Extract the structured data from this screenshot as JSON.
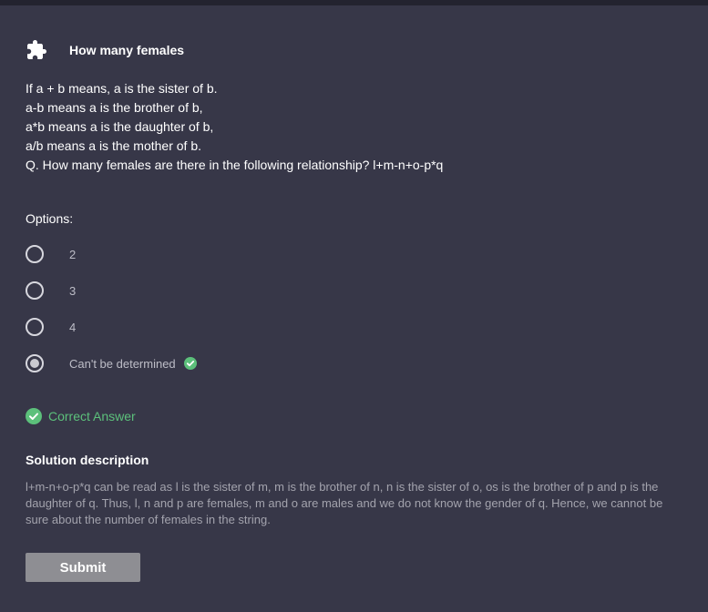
{
  "header": {
    "title": "How many females",
    "icon": "puzzle-icon"
  },
  "question": {
    "lines": [
      "If a + b means, a is the sister of b.",
      "a-b means a is the brother of b,",
      "a*b means a is the daughter of b,",
      "a/b means a is the mother of b.",
      "Q. How many females are there in the following relationship? l+m-n+o-p*q"
    ]
  },
  "options": {
    "label": "Options:",
    "items": [
      {
        "label": "2",
        "selected": false,
        "correct": false
      },
      {
        "label": "3",
        "selected": false,
        "correct": false
      },
      {
        "label": "4",
        "selected": false,
        "correct": false
      },
      {
        "label": "Can't be determined",
        "selected": true,
        "correct": true
      }
    ]
  },
  "result": {
    "text": "Correct Answer",
    "color": "#5cc07b"
  },
  "solution": {
    "title": "Solution description",
    "text": "l+m-n+o-p*q can be read as l is the sister of m, m is the brother of n, n is the sister of o, os is the brother of p and p is the daughter of q. Thus, l, n and p are females, m and o are males and we do not know the gender of q. Hence, we cannot be sure about the number of females in the string."
  },
  "submit": {
    "label": "Submit"
  },
  "colors": {
    "background": "#373748",
    "top_strip": "#23232f",
    "accent_green": "#5cc07b",
    "submit_bg": "#8e8e93"
  }
}
